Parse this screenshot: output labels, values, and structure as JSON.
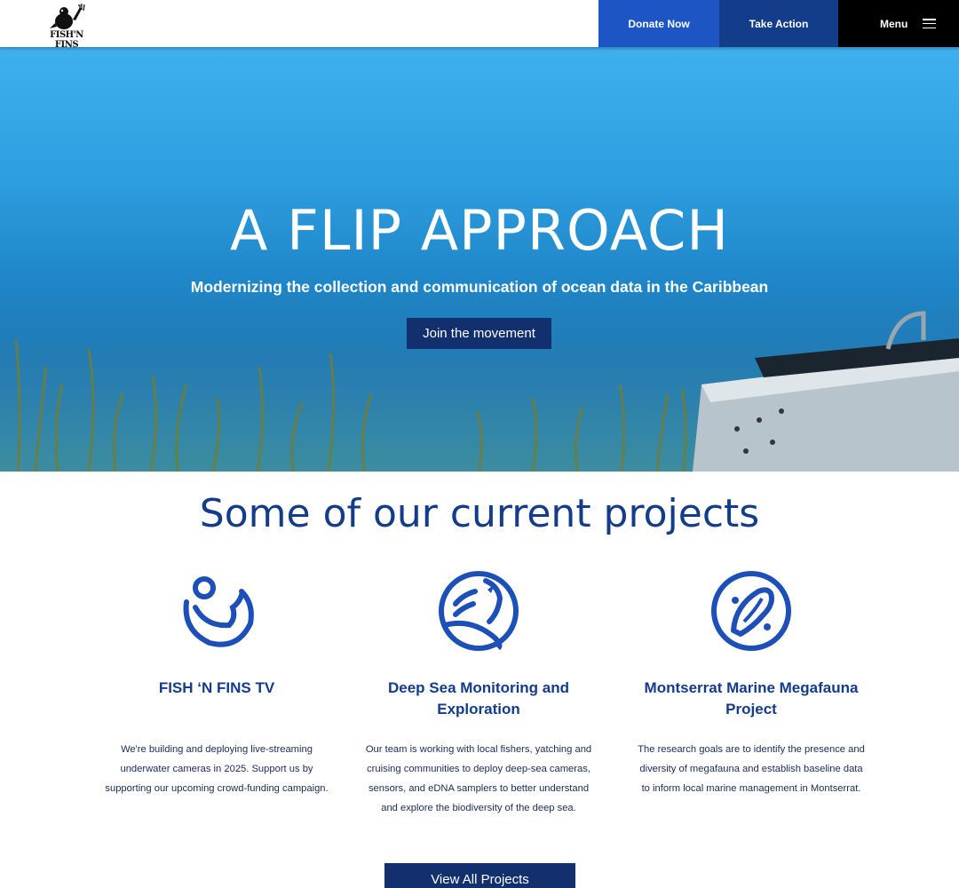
{
  "header": {
    "logo_text": "FISH'N FINS",
    "donate_label": "Donate Now",
    "action_label": "Take Action",
    "menu_label": "Menu"
  },
  "hero": {
    "title": "A FLIP APPROACH",
    "subtitle": "Modernizing the collection and communication of ocean data in the Caribbean",
    "cta_label": "Join the movement"
  },
  "projects": {
    "heading": "Some of our current projects",
    "items": [
      {
        "icon": "diver-wave-icon",
        "title": "FISH ‘N FINS TV",
        "text": "We're building and deploying  live-streaming underwater cameras in 2025. Support us by supporting our upcoming crowd-funding campaign."
      },
      {
        "icon": "whale-icon",
        "title": "Deep Sea Monitoring and Exploration",
        "text": "Our team is working with local fishers, yatching and cruising communities to deploy deep-sea cameras, sensors, and eDNA samplers to better understand and explore the biodiversity of the deep sea."
      },
      {
        "icon": "manta-ray-icon",
        "title": "Montserrat Marine Megafauna Project",
        "text": "The research goals are to identify the presence and diversity of megafauna and establish baseline data to inform local marine management in Montserrat."
      }
    ],
    "view_all_label": "View All Projects"
  },
  "colors": {
    "brand_blue": "#1d55c4",
    "navy": "#133c8b",
    "button_navy": "#12306e"
  }
}
